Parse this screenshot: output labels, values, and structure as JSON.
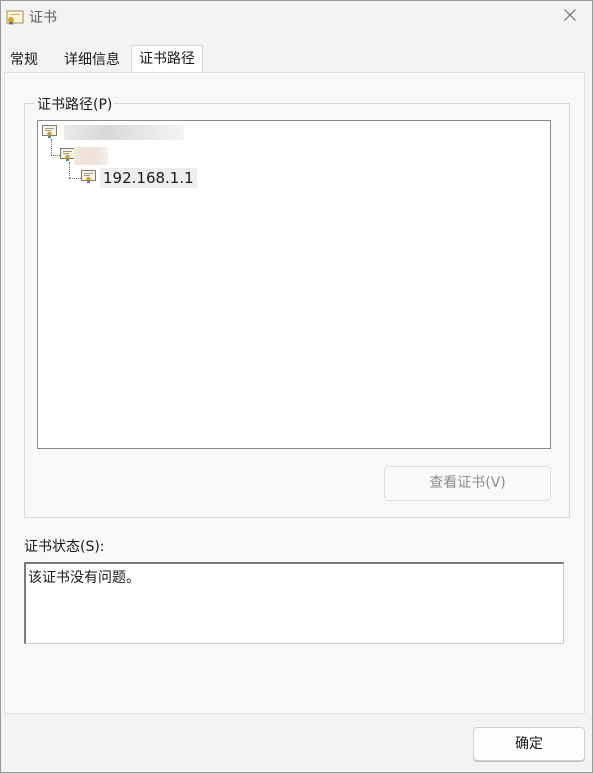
{
  "window": {
    "title": "证书",
    "icons": {
      "title": "certificate-icon",
      "close": "close-icon"
    }
  },
  "tabs": [
    {
      "label": "常规"
    },
    {
      "label": "详细信息"
    },
    {
      "label": "证书路径",
      "selected": true
    }
  ],
  "cert_path": {
    "group_label": "证书路径(P)",
    "tree": {
      "root_label": "",
      "intermediate_label": "",
      "leaf_label": "192.168.1.1"
    },
    "view_button": {
      "label": "查看证书(V)",
      "enabled": false
    }
  },
  "status": {
    "label": "证书状态(S):",
    "text": "该证书没有问题。"
  },
  "footer": {
    "ok_label": "确定"
  },
  "colors": {
    "cert_icon_seal": "#e0a020",
    "disabled_text": "#8d8d8d"
  }
}
